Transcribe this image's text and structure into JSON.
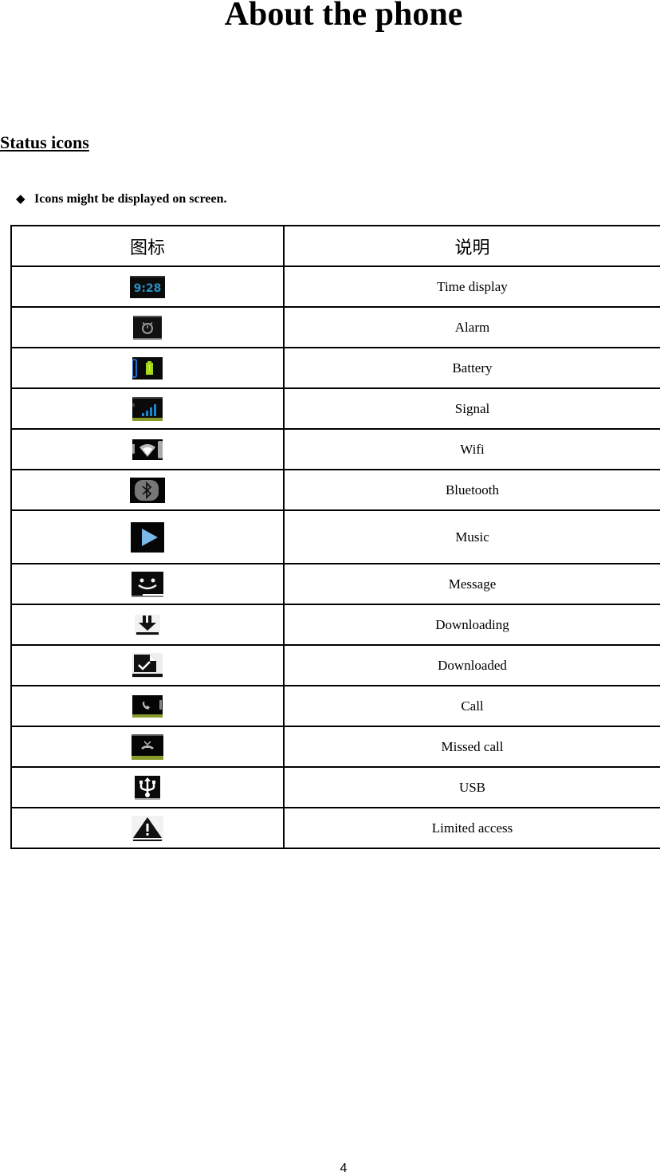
{
  "document": {
    "title": "About the phone",
    "section_heading": "Status icons",
    "bullet_text": "Icons might be displayed on screen.",
    "page_number": "4"
  },
  "table": {
    "headers": [
      "图标",
      "说明"
    ],
    "rows": [
      {
        "icon": "time-display-icon",
        "icon_text": "9:28",
        "label": "Time display"
      },
      {
        "icon": "alarm-icon",
        "label": "Alarm"
      },
      {
        "icon": "battery-icon",
        "label": "Battery"
      },
      {
        "icon": "signal-icon",
        "label": "Signal"
      },
      {
        "icon": "wifi-icon",
        "label": "Wifi"
      },
      {
        "icon": "bluetooth-icon",
        "label": "Bluetooth"
      },
      {
        "icon": "music-play-icon",
        "label": "Music"
      },
      {
        "icon": "message-icon",
        "label": "Message"
      },
      {
        "icon": "downloading-icon",
        "label": "Downloading"
      },
      {
        "icon": "downloaded-icon",
        "label": "Downloaded"
      },
      {
        "icon": "call-icon",
        "label": "Call"
      },
      {
        "icon": "missed-call-icon",
        "label": "Missed call"
      },
      {
        "icon": "usb-icon",
        "label": "USB"
      },
      {
        "icon": "limited-access-warning-icon",
        "label": "Limited access"
      }
    ]
  },
  "colors": {
    "time_text": "#2a8fc0",
    "battery_green": "#a6d81e",
    "battery_blue": "#1e6fd0",
    "signal_blue": "#1a86d0",
    "status_bar_olive": "#8a9a2a",
    "music_play": "#7ab8e8"
  }
}
